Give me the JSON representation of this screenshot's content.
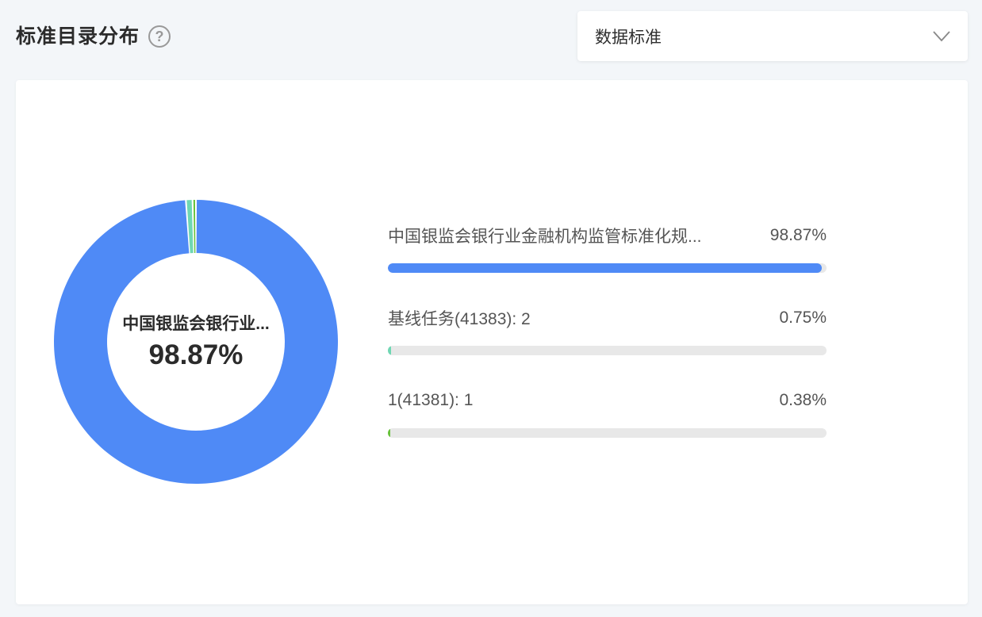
{
  "header": {
    "title": "标准目录分布",
    "help_icon": "question-circle-icon"
  },
  "select": {
    "value": "数据标准",
    "icon": "chevron-down-icon"
  },
  "colors": {
    "series": [
      "#4f8af6",
      "#6fd7b3",
      "#67c23a"
    ],
    "track": "#e8e8e8"
  },
  "chart_data": {
    "type": "pie",
    "style": "donut",
    "center": {
      "label": "中国银监会银行业...",
      "value": "98.87%"
    },
    "series": [
      {
        "name": "中国银监会银行业金融机构监管标准化规...",
        "label": "中国银监会银行业金融机构监管标准化规...",
        "percent_label": "98.87%",
        "percent": 98.87
      },
      {
        "name": "基线任务(41383)",
        "label": "基线任务(41383): 2",
        "percent_label": "0.75%",
        "percent": 0.75,
        "count": 2
      },
      {
        "name": "1(41381)",
        "label": "1(41381): 1",
        "percent_label": "0.38%",
        "percent": 0.38,
        "count": 1
      }
    ],
    "legend": "right"
  }
}
